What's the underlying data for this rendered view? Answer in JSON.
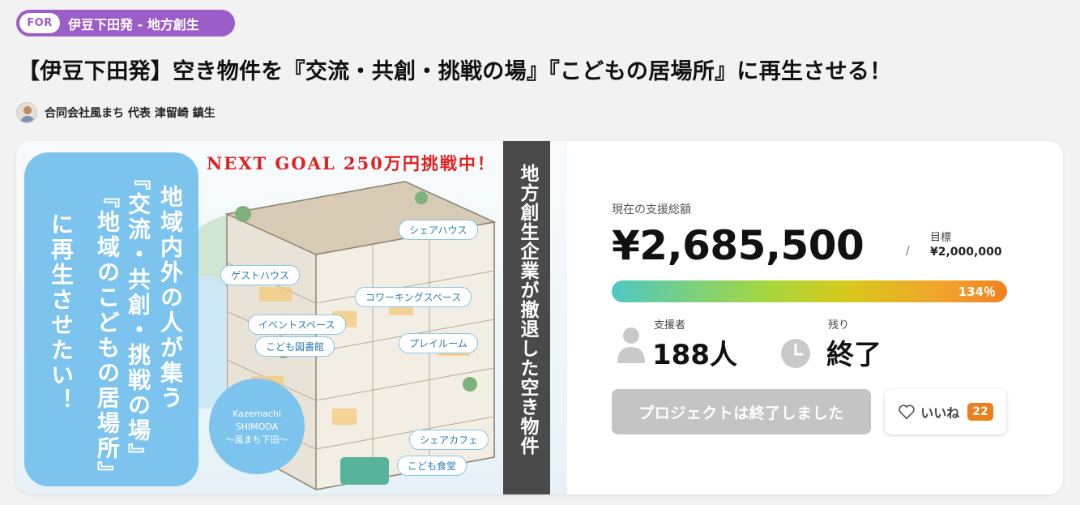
{
  "tag": {
    "prefix": "FOR",
    "category": "伊豆下田発 - 地方創生"
  },
  "project": {
    "title": "【伊豆下田発】空き物件を『交流・共創・挑戦の場』『こどもの居場所』に再生させる！",
    "owner": "合同会社風まち 代表 津留崎 鎮生"
  },
  "image": {
    "goal_banner": "NEXT GOAL 250万円挑戦中！",
    "line1": "地域内外の人が集う",
    "line2": "『交流・共創・挑戦の場』",
    "line3": "『地域のこどもの居場所』",
    "line4": "に再生させたい！",
    "side_text": "地方創生企業が撤退した空き物件",
    "labels": [
      "シェアハウス",
      "ゲストハウス",
      "コワーキングスペース",
      "イベントスペース",
      "こども図書館",
      "プレイルーム",
      "シェアカフェ",
      "こども食堂"
    ],
    "logo_line1": "Kazemachi",
    "logo_line2": "SHIMODA",
    "logo_line3": "〜風まち下田〜"
  },
  "stats": {
    "total_label": "現在の支援総額",
    "total": "¥2,685,500",
    "slash": "/",
    "goal_label": "目標",
    "goal": "¥2,000,000",
    "percent_text": "134％",
    "progress_fraction": 1.0,
    "supporters_label": "支援者",
    "supporters": "188人",
    "remaining_label": "残り",
    "remaining": "終了",
    "ended_button": "プロジェクトは終了しました",
    "like_label": "いいね",
    "like_count": "22"
  },
  "colors": {
    "tag": "#9b5dc8",
    "like_badge": "#ee7d1c",
    "image_blue": "#7cc3ee",
    "goal_red": "#e02020"
  }
}
